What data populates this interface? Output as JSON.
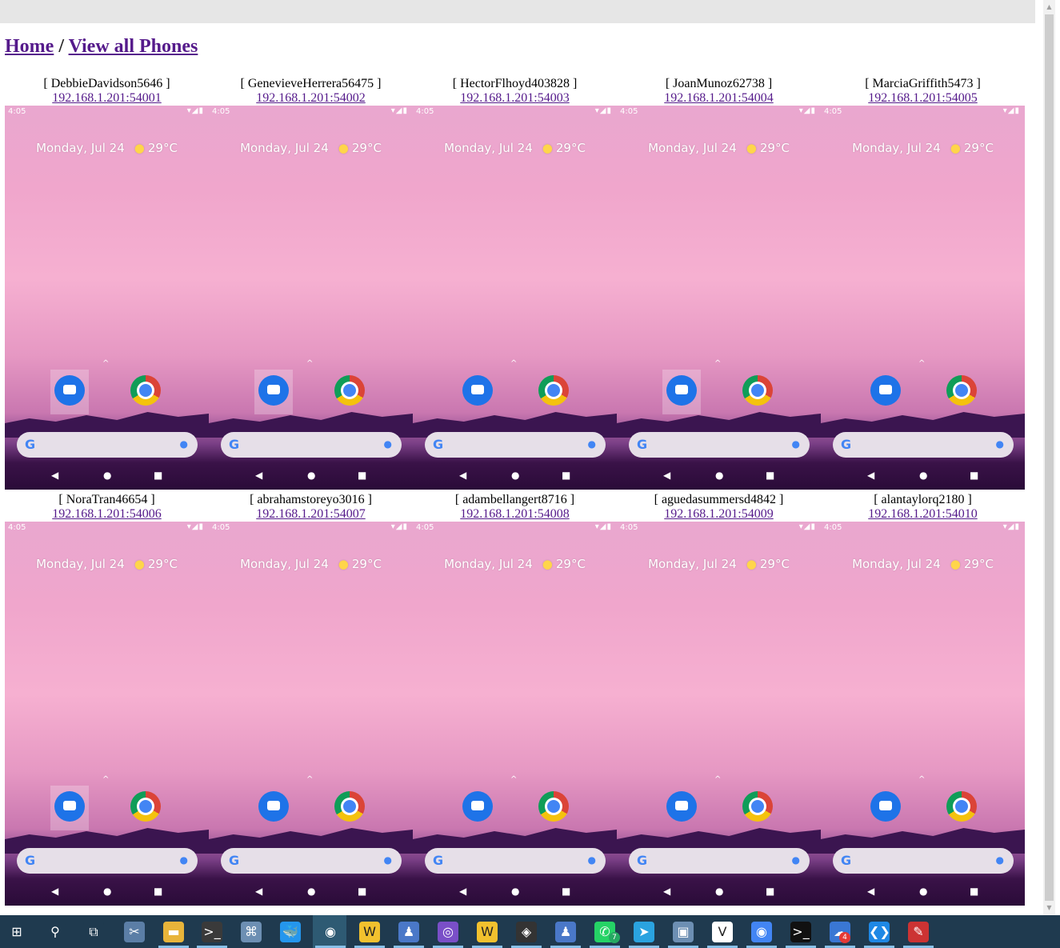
{
  "breadcrumb": {
    "home": "Home",
    "separator": "/",
    "current": "View all Phones"
  },
  "phones": [
    {
      "name": "[ DebbieDavidson5646 ]",
      "address": "192.168.1.201:54001"
    },
    {
      "name": "[ GenevieveHerrera56475 ]",
      "address": "192.168.1.201:54002"
    },
    {
      "name": "[ HectorFlhoyd403828 ]",
      "address": "192.168.1.201:54003"
    },
    {
      "name": "[ JoanMunoz62738 ]",
      "address": "192.168.1.201:54004"
    },
    {
      "name": "[ MarciaGriffith5473 ]",
      "address": "192.168.1.201:54005"
    },
    {
      "name": "[ NoraTran46654 ]",
      "address": "192.168.1.201:54006"
    },
    {
      "name": "[ abrahamstoreyo3016 ]",
      "address": "192.168.1.201:54007"
    },
    {
      "name": "[ adambellangert8716 ]",
      "address": "192.168.1.201:54008"
    },
    {
      "name": "[ aguedasummersd4842 ]",
      "address": "192.168.1.201:54009"
    },
    {
      "name": "[ alantaylorq2180 ]",
      "address": "192.168.1.201:54010"
    }
  ],
  "screen": {
    "time": "4:05",
    "date_widget": "Monday, Jul 24",
    "temperature": "29°C",
    "status_icons": "▾◢▮",
    "search_logo": "G",
    "mic": "●"
  },
  "nav": {
    "back": "◀",
    "home": "●",
    "recent": "■"
  },
  "taskbar": {
    "icons": [
      {
        "name": "windows-start-icon",
        "glyph": "⊞",
        "bg": "#1f3a4f"
      },
      {
        "name": "search-icon",
        "glyph": "⚲",
        "bg": "#1f3a4f"
      },
      {
        "name": "task-view-icon",
        "glyph": "⧉",
        "bg": "#1f3a4f"
      },
      {
        "name": "snipping-icon",
        "glyph": "✂",
        "bg": "#5b7ea6"
      },
      {
        "name": "file-explorer-icon",
        "glyph": "▬",
        "bg": "#e8b43a"
      },
      {
        "name": "terminal-icon",
        "glyph": ">_",
        "bg": "#3a3a3a"
      },
      {
        "name": "network-icon",
        "glyph": "⌘",
        "bg": "#6d8fb3"
      },
      {
        "name": "docker-icon",
        "glyph": "🐳",
        "bg": "#2496ed"
      },
      {
        "name": "chrome-icon",
        "glyph": "◉",
        "bg": "#2e5a73"
      },
      {
        "name": "app-w-icon",
        "glyph": "W",
        "bg": "#f2c12e"
      },
      {
        "name": "robot-icon",
        "glyph": "♟",
        "bg": "#4a78c8"
      },
      {
        "name": "github-icon",
        "glyph": "◎",
        "bg": "#7a4fc8"
      },
      {
        "name": "app-w2-icon",
        "glyph": "W",
        "bg": "#f2c12e"
      },
      {
        "name": "davinci-icon",
        "glyph": "◈",
        "bg": "#333333"
      },
      {
        "name": "robot2-icon",
        "glyph": "♟",
        "bg": "#4a78c8"
      },
      {
        "name": "whatsapp-icon",
        "glyph": "✆",
        "bg": "#25d366"
      },
      {
        "name": "telegram-icon",
        "glyph": "➤",
        "bg": "#2aa3e0"
      },
      {
        "name": "photo-icon",
        "glyph": "▣",
        "bg": "#6d8fb3"
      },
      {
        "name": "vex-icon",
        "glyph": "V",
        "bg": "#ffffff"
      },
      {
        "name": "chrome2-icon",
        "glyph": "◉",
        "bg": "#4285f4"
      },
      {
        "name": "cmd-icon",
        "glyph": ">_",
        "bg": "#111111"
      },
      {
        "name": "cloud-icon",
        "glyph": "☁",
        "bg": "#3a77d4"
      },
      {
        "name": "vscode-icon",
        "glyph": "❮❯",
        "bg": "#1e88e5"
      },
      {
        "name": "paint-icon",
        "glyph": "✎",
        "bg": "#c33"
      }
    ],
    "whatsapp_badge": "7",
    "cloud_badge": "4",
    "badge_color": "#e53935"
  }
}
